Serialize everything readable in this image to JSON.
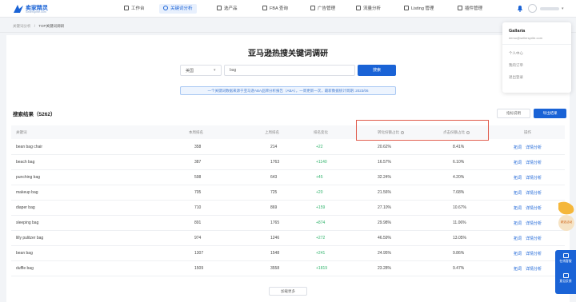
{
  "brand": {
    "name": "卖家精灵",
    "tagline": "SellerSprite.com",
    "color": "#1a63d6"
  },
  "nav": [
    {
      "label": "工作台",
      "icon": "dashboard-icon",
      "active": false
    },
    {
      "label": "关键词分析",
      "icon": "keyword-icon",
      "active": true
    },
    {
      "label": "选产品",
      "icon": "product-icon",
      "active": false
    },
    {
      "label": "FBA 查询",
      "icon": "fba-icon",
      "active": false
    },
    {
      "label": "广告管理",
      "icon": "ads-icon",
      "active": false
    },
    {
      "label": "流量分析",
      "icon": "traffic-icon",
      "active": false
    },
    {
      "label": "Listing 管理",
      "icon": "listing-icon",
      "active": false
    },
    {
      "label": "插件管理",
      "icon": "plugin-icon",
      "active": false
    }
  ],
  "breadcrumb": {
    "parent": "关键词分析",
    "separator": "/",
    "current": "TOP关键词调研"
  },
  "page": {
    "title": "亚马逊热搜关键词调研"
  },
  "search": {
    "market": "美国",
    "keyword": "bag",
    "button": "搜索",
    "hint": "一个关键词数据来源于亚马逊ABA品牌分析报告（ABA），一周更新一次，最新数据统计周期: 2023/06"
  },
  "results": {
    "title": "搜索结果（5262）",
    "desc_button": "指标说明",
    "export_button": "导出结果",
    "columns": [
      "关键词",
      "本周排名",
      "上周排名",
      "排名变化",
      "转化份额占比",
      "点击份额占比",
      "操作"
    ],
    "rows": [
      {
        "keyword": "bean bag chair",
        "this_week": "358",
        "last_week": "214",
        "change": "+22",
        "conv_share": "20.62%",
        "click_share": "8.41%"
      },
      {
        "keyword": "beach bag",
        "this_week": "387",
        "last_week": "1763",
        "change": "+1140",
        "conv_share": "16.57%",
        "click_share": "6.10%"
      },
      {
        "keyword": "punching bag",
        "this_week": "598",
        "last_week": "643",
        "change": "+45",
        "conv_share": "32.24%",
        "click_share": "4.20%"
      },
      {
        "keyword": "makeup bag",
        "this_week": "705",
        "last_week": "725",
        "change": "+20",
        "conv_share": "21.56%",
        "click_share": "7.68%"
      },
      {
        "keyword": "diaper bag",
        "this_week": "710",
        "last_week": "869",
        "change": "+159",
        "conv_share": "27.10%",
        "click_share": "10.67%"
      },
      {
        "keyword": "sleeping bag",
        "this_week": "891",
        "last_week": "1765",
        "change": "+874",
        "conv_share": "29.98%",
        "click_share": "11.06%"
      },
      {
        "keyword": "lilly pulitzer bag",
        "this_week": "974",
        "last_week": "1246",
        "change": "+272",
        "conv_share": "46.59%",
        "click_share": "13.05%"
      },
      {
        "keyword": "bean bag",
        "this_week": "1307",
        "last_week": "1548",
        "change": "+241",
        "conv_share": "24.95%",
        "click_share": "9.86%"
      },
      {
        "keyword": "duffle bag",
        "this_week": "1509",
        "last_week": "3558",
        "change": "+1819",
        "conv_share": "23.28%",
        "click_share": "9.47%"
      }
    ],
    "row_actions": [
      "拓词",
      "详情分析"
    ],
    "load_more": "加载更多"
  },
  "user_menu": {
    "name": "Gallaria",
    "email": "demo@sellersprite.com",
    "items": [
      "个人中心",
      "我的订单",
      "退出登录"
    ]
  },
  "float_widgets": {
    "badge_label": "精选活动",
    "items": [
      "在线客服",
      "意见反馈"
    ]
  },
  "colors": {
    "accent": "#1a63d6",
    "positive": "#2fb36b",
    "highlight_border": "#e05a4b"
  }
}
